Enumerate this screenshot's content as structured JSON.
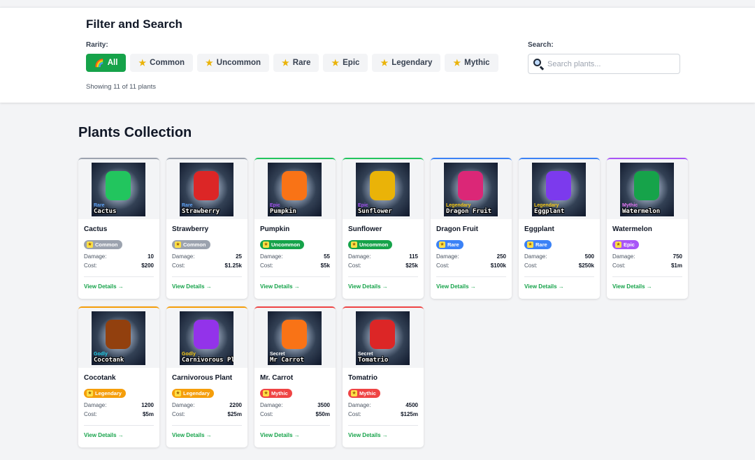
{
  "filter": {
    "title": "Filter and Search",
    "rarity_label": "Rarity:",
    "buttons": [
      {
        "label": "All",
        "icon": "rainbow-icon",
        "active": true
      },
      {
        "label": "Common",
        "icon": "star-icon"
      },
      {
        "label": "Uncommon",
        "icon": "star-icon"
      },
      {
        "label": "Rare",
        "icon": "star-icon"
      },
      {
        "label": "Epic",
        "icon": "star-icon"
      },
      {
        "label": "Legendary",
        "icon": "star-icon"
      },
      {
        "label": "Mythic",
        "icon": "star-icon"
      }
    ],
    "showing": "Showing 11 of 11 plants",
    "search_label": "Search:",
    "search_placeholder": "Search plants..."
  },
  "collection": {
    "title": "Plants Collection",
    "damage_label": "Damage:",
    "cost_label": "Cost:",
    "details_label": "View Details →",
    "plants": [
      {
        "name": "Cactus",
        "rarity": "Common",
        "damage": "10",
        "cost": "$200",
        "thumb_tier": "Rare",
        "thumb_name": "Cactus",
        "tier_color": "#60a5fa",
        "sprite_color": "#22c55e"
      },
      {
        "name": "Strawberry",
        "rarity": "Common",
        "damage": "25",
        "cost": "$1.25k",
        "thumb_tier": "Rare",
        "thumb_name": "Strawberry",
        "tier_color": "#60a5fa",
        "sprite_color": "#dc2626"
      },
      {
        "name": "Pumpkin",
        "rarity": "Uncommon",
        "damage": "55",
        "cost": "$5k",
        "thumb_tier": "Epic",
        "thumb_name": "Pumpkin",
        "tier_color": "#a855f7",
        "sprite_color": "#f97316"
      },
      {
        "name": "Sunflower",
        "rarity": "Uncommon",
        "damage": "115",
        "cost": "$25k",
        "thumb_tier": "Epic",
        "thumb_name": "Sunflower",
        "tier_color": "#a855f7",
        "sprite_color": "#eab308"
      },
      {
        "name": "Dragon Fruit",
        "rarity": "Rare",
        "damage": "250",
        "cost": "$100k",
        "thumb_tier": "Legendary",
        "thumb_name": "Dragon Fruit",
        "tier_color": "#facc15",
        "sprite_color": "#db2777"
      },
      {
        "name": "Eggplant",
        "rarity": "Rare",
        "damage": "500",
        "cost": "$250k",
        "thumb_tier": "Legendary",
        "thumb_name": "Eggplant",
        "tier_color": "#facc15",
        "sprite_color": "#7c3aed"
      },
      {
        "name": "Watermelon",
        "rarity": "Epic",
        "damage": "750",
        "cost": "$1m",
        "thumb_tier": "Mythic",
        "thumb_name": "Watermelon",
        "tier_color": "#e879f9",
        "sprite_color": "#16a34a"
      },
      {
        "name": "Cocotank",
        "rarity": "Legendary",
        "damage": "1200",
        "cost": "$5m",
        "thumb_tier": "Godly",
        "thumb_name": "Cocotank",
        "tier_color": "#22d3ee",
        "sprite_color": "#92400e"
      },
      {
        "name": "Carnivorous Plant",
        "rarity": "Legendary",
        "damage": "2200",
        "cost": "$25m",
        "thumb_tier": "Godly",
        "thumb_name": "Carnivorous Plant",
        "tier_color": "#facc15",
        "sprite_color": "#9333ea"
      },
      {
        "name": "Mr. Carrot",
        "rarity": "Mythic",
        "damage": "3500",
        "cost": "$50m",
        "thumb_tier": "Secret",
        "thumb_name": "Mr Carrot",
        "tier_color": "#ffffff",
        "sprite_color": "#f97316"
      },
      {
        "name": "Tomatrio",
        "rarity": "Mythic",
        "damage": "4500",
        "cost": "$125m",
        "thumb_tier": "Secret",
        "thumb_name": "Tomatrio",
        "tier_color": "#ffffff",
        "sprite_color": "#dc2626"
      }
    ]
  }
}
